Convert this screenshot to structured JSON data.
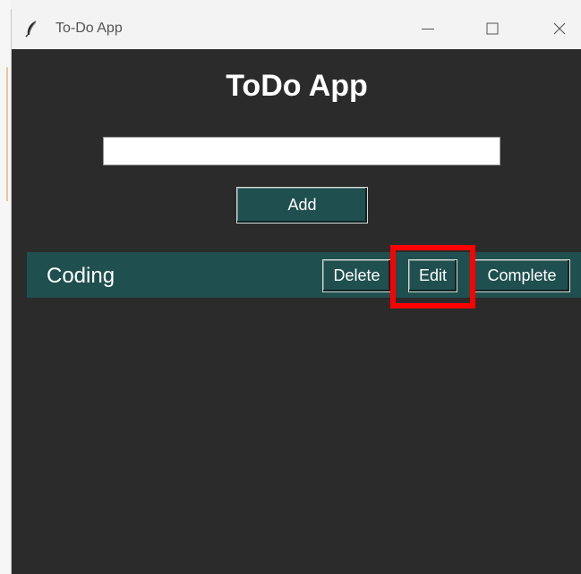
{
  "window": {
    "title": "To-Do App"
  },
  "app": {
    "heading": "ToDo App"
  },
  "input": {
    "value": "",
    "placeholder": ""
  },
  "buttons": {
    "add": "Add"
  },
  "tasks": [
    {
      "label": "Coding",
      "delete": "Delete",
      "edit": "Edit",
      "complete": "Complete"
    }
  ],
  "colors": {
    "background": "#2b2b2b",
    "accent": "#1f4f4f",
    "highlight": "#ff0000"
  }
}
